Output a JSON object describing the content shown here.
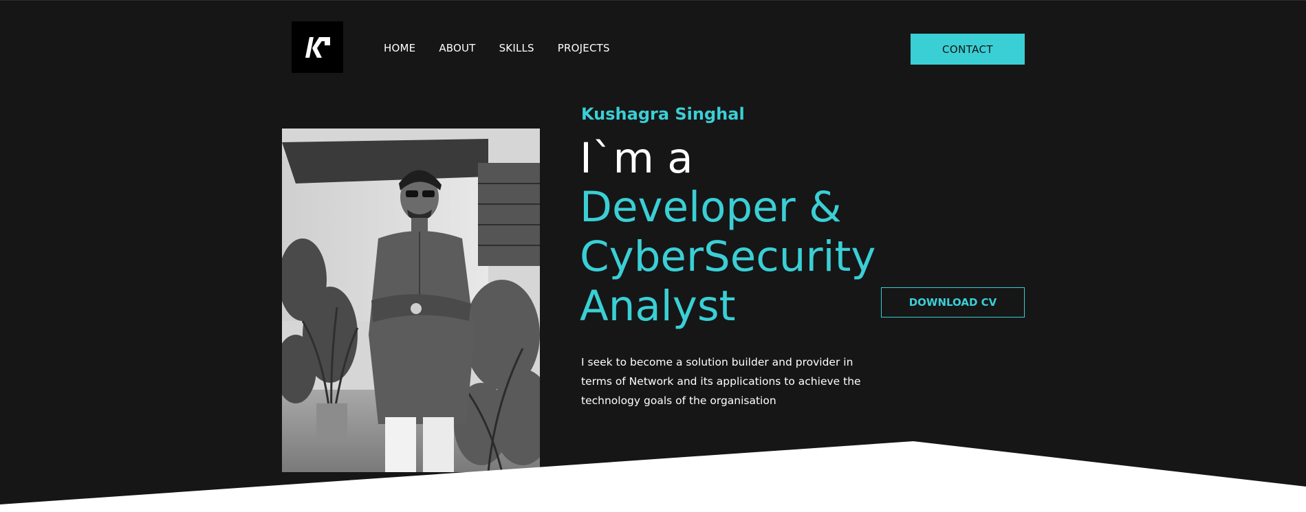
{
  "nav": {
    "logo_text": "KP",
    "items": [
      {
        "label": "HOME"
      },
      {
        "label": "ABOUT"
      },
      {
        "label": "SKILLS"
      },
      {
        "label": "PROJECTS"
      }
    ],
    "contact_label": "CONTACT"
  },
  "hero": {
    "name": "Kushagra Singhal",
    "intro": "I`m a",
    "role_lines": [
      "Developer &",
      "CyberSecurity",
      "Analyst"
    ],
    "description": "I seek to become a solution builder and provider in terms of Network and its applications to achieve the technology goals of the organisation",
    "download_label": "DOWNLOAD CV"
  },
  "colors": {
    "background": "#161617",
    "accent": "#3acfd5",
    "text": "#ffffff",
    "footer_shape": "#ffffff"
  },
  "icons": {
    "logo": "kp-monogram-icon"
  }
}
